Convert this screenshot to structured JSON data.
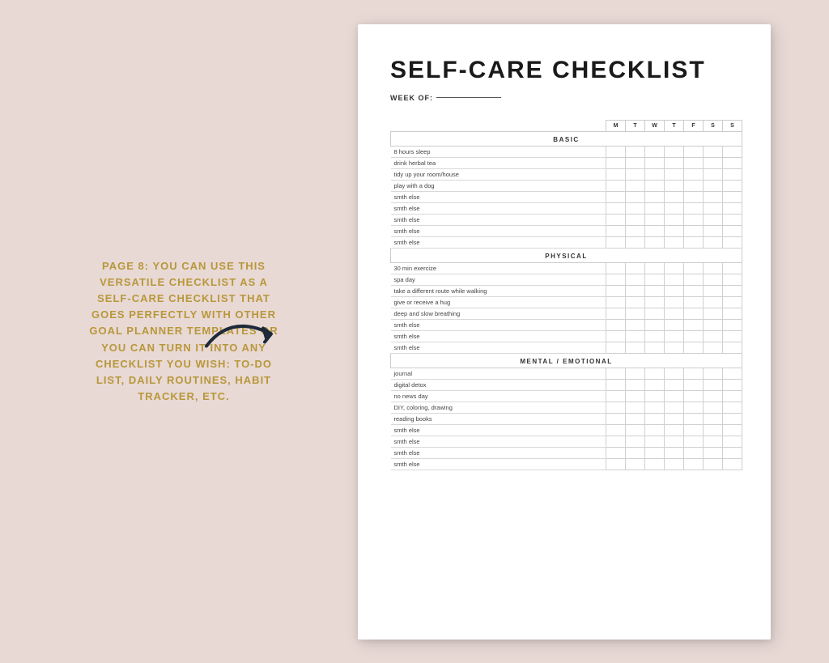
{
  "left": {
    "page_label": "PAGE 8:",
    "description": "YOU CAN USE THIS VERSATILE CHECKLIST AS A SELF-CARE CHECKLIST THAT GOES PERFECTLY WITH OTHER GOAL PLANNER TEMPLATES OR YOU CAN TURN IT INTO ANY CHECKLIST YOU WISH: TO-DO LIST, DAILY ROUTINES, HABIT TRACKER, ETC."
  },
  "doc": {
    "title": "SELF-CARE CHECKLIST",
    "week_of_label": "WEEK OF:",
    "days": [
      "M",
      "T",
      "W",
      "T",
      "F",
      "S",
      "S"
    ],
    "sections": [
      {
        "name": "BASIC",
        "items": [
          "8 hours sleep",
          "drink herbal tea",
          "tidy up your room/house",
          "play with a dog",
          "smth else",
          "smth else",
          "smth else",
          "smth else",
          "smth else"
        ]
      },
      {
        "name": "PHYSICAL",
        "items": [
          "30 min exercize",
          "spa day",
          "take a different route while walking",
          "give or receive a hug",
          "deep and slow breathing",
          "smth else",
          "smth else",
          "smth else"
        ]
      },
      {
        "name": "MENTAL / EMOTIONAL",
        "items": [
          "journal",
          "digital detox",
          "no news day",
          "DIY, coloring, drawing",
          "reading books",
          "smth else",
          "smth else",
          "smth else",
          "smth else"
        ]
      }
    ]
  }
}
